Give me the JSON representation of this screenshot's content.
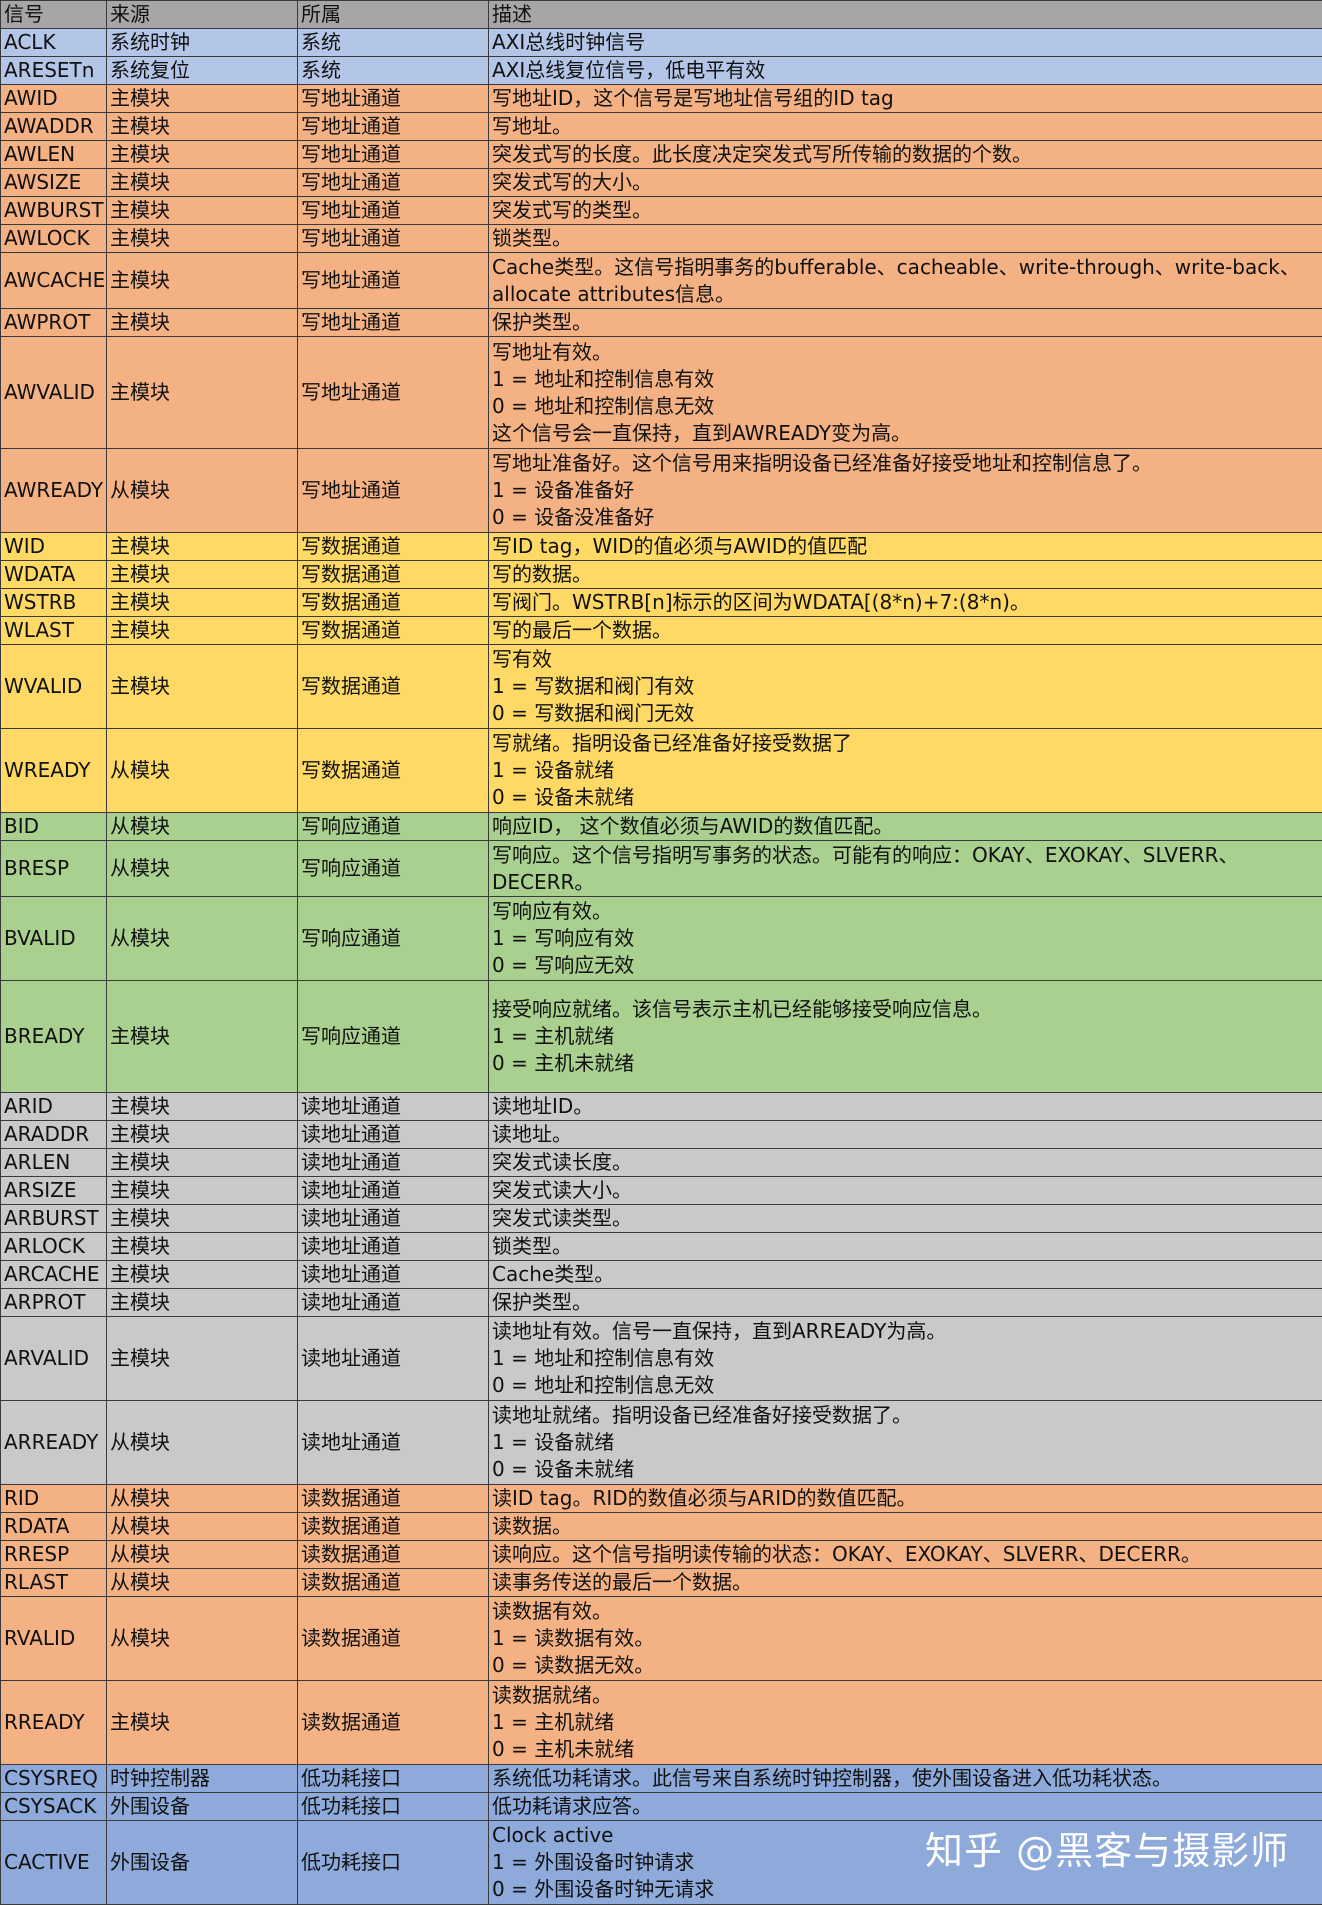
{
  "header": {
    "signal": "信号",
    "source": "来源",
    "group": "所属",
    "desc": "描述"
  },
  "rows": [
    {
      "cls": "sys",
      "h": 26,
      "signal": "ACLK",
      "source": "系统时钟",
      "group": "系统",
      "desc": [
        "AXI总线时钟信号"
      ]
    },
    {
      "cls": "sys",
      "h": 28,
      "signal": "ARESETn",
      "source": "系统复位",
      "group": "系统",
      "desc": [
        "AXI总线复位信号，低电平有效"
      ]
    },
    {
      "cls": "wa",
      "h": 28,
      "signal": "AWID",
      "source": "主模块",
      "group": "写地址通道",
      "desc": [
        "写地址ID，这个信号是写地址信号组的ID tag"
      ]
    },
    {
      "cls": "wa",
      "h": 28,
      "signal": "AWADDR",
      "source": "主模块",
      "group": "写地址通道",
      "desc": [
        "写地址。"
      ]
    },
    {
      "cls": "wa",
      "h": 28,
      "signal": "AWLEN",
      "source": "主模块",
      "group": "写地址通道",
      "desc": [
        "突发式写的长度。此长度决定突发式写所传输的数据的个数。"
      ]
    },
    {
      "cls": "wa",
      "h": 28,
      "signal": "AWSIZE",
      "source": "主模块",
      "group": "写地址通道",
      "desc": [
        "突发式写的大小。"
      ]
    },
    {
      "cls": "wa",
      "h": 28,
      "signal": "AWBURST",
      "source": "主模块",
      "group": "写地址通道",
      "desc": [
        "突发式写的类型。"
      ]
    },
    {
      "cls": "wa",
      "h": 28,
      "signal": "AWLOCK",
      "source": "主模块",
      "group": "写地址通道",
      "desc": [
        "锁类型。"
      ]
    },
    {
      "cls": "wa",
      "h": 56,
      "signal": "AWCACHE",
      "source": "主模块",
      "group": "写地址通道",
      "desc": [
        "Cache类型。这信号指明事务的bufferable、cacheable、write-through、write-back、allocate attributes信息。"
      ]
    },
    {
      "cls": "wa",
      "h": 28,
      "signal": "AWPROT",
      "source": "主模块",
      "group": "写地址通道",
      "desc": [
        "保护类型。"
      ]
    },
    {
      "cls": "wa",
      "h": 112,
      "signal": "AWVALID",
      "source": "主模块",
      "group": "写地址通道",
      "desc": [
        "写地址有效。",
        "1 = 地址和控制信息有效",
        "0 = 地址和控制信息无效",
        "这个信号会一直保持，直到AWREADY变为高。"
      ]
    },
    {
      "cls": "wa",
      "h": 84,
      "signal": "AWREADY",
      "source": "从模块",
      "group": "写地址通道",
      "desc": [
        "写地址准备好。这个信号用来指明设备已经准备好接受地址和控制信息了。",
        "1 = 设备准备好",
        "0 =  设备没准备好"
      ]
    },
    {
      "cls": "wd",
      "h": 28,
      "signal": "WID",
      "source": "主模块",
      "group": "写数据通道",
      "desc": [
        "写ID tag，WID的值必须与AWID的值匹配"
      ]
    },
    {
      "cls": "wd",
      "h": 28,
      "signal": "WDATA",
      "source": "主模块",
      "group": "写数据通道",
      "desc": [
        "写的数据。"
      ]
    },
    {
      "cls": "wd",
      "h": 28,
      "signal": "WSTRB",
      "source": "主模块",
      "group": "写数据通道",
      "desc": [
        "写阀门。WSTRB[n]标示的区间为WDATA[(8*n)+7:(8*n)。"
      ]
    },
    {
      "cls": "wd",
      "h": 28,
      "signal": "WLAST",
      "source": "主模块",
      "group": "写数据通道",
      "desc": [
        "写的最后一个数据。"
      ]
    },
    {
      "cls": "wd",
      "h": 84,
      "signal": "WVALID",
      "source": "主模块",
      "group": "写数据通道",
      "desc": [
        "写有效",
        "1 = 写数据和阀门有效",
        "0 =  写数据和阀门无效"
      ]
    },
    {
      "cls": "wd",
      "h": 84,
      "signal": "WREADY",
      "source": "从模块",
      "group": "写数据通道",
      "desc": [
        "写就绪。指明设备已经准备好接受数据了",
        "1 = 设备就绪",
        "0 = 设备未就绪"
      ]
    },
    {
      "cls": "wr",
      "h": 28,
      "signal": "BID",
      "source": "从模块",
      "group": "写响应通道",
      "desc": [
        "响应ID，  这个数值必须与AWID的数值匹配。"
      ]
    },
    {
      "cls": "wr",
      "h": 56,
      "signal": "BRESP",
      "source": "从模块",
      "group": "写响应通道",
      "desc": [
        "写响应。这个信号指明写事务的状态。可能有的响应：OKAY、EXOKAY、SLVERR、DECERR。"
      ]
    },
    {
      "cls": "wr",
      "h": 84,
      "signal": "BVALID",
      "source": "从模块",
      "group": "写响应通道",
      "desc": [
        "写响应有效。",
        "1 = 写响应有效",
        "0 = 写响应无效"
      ]
    },
    {
      "cls": "wr",
      "h": 112,
      "signal": "BREADY",
      "source": "主模块",
      "group": "写响应通道",
      "desc": [
        "接受响应就绪。该信号表示主机已经能够接受响应信息。",
        "1 = 主机就绪",
        "0 = 主机未就绪"
      ]
    },
    {
      "cls": "ra",
      "h": 28,
      "signal": "ARID",
      "source": "主模块",
      "group": "读地址通道",
      "desc": [
        "读地址ID。"
      ]
    },
    {
      "cls": "ra",
      "h": 28,
      "signal": "ARADDR",
      "source": "主模块",
      "group": "读地址通道",
      "desc": [
        "读地址。"
      ]
    },
    {
      "cls": "ra",
      "h": 28,
      "signal": "ARLEN",
      "source": "主模块",
      "group": "读地址通道",
      "desc": [
        "突发式读长度。"
      ]
    },
    {
      "cls": "ra",
      "h": 28,
      "signal": "ARSIZE",
      "source": "主模块",
      "group": "读地址通道",
      "desc": [
        "突发式读大小。"
      ]
    },
    {
      "cls": "ra",
      "h": 28,
      "signal": "ARBURST",
      "source": "主模块",
      "group": "读地址通道",
      "desc": [
        "突发式读类型。"
      ]
    },
    {
      "cls": "ra",
      "h": 28,
      "signal": "ARLOCK",
      "source": "主模块",
      "group": "读地址通道",
      "desc": [
        "锁类型。"
      ]
    },
    {
      "cls": "ra",
      "h": 28,
      "signal": "ARCACHE",
      "source": "主模块",
      "group": "读地址通道",
      "desc": [
        "Cache类型。"
      ]
    },
    {
      "cls": "ra",
      "h": 28,
      "signal": "ARPROT",
      "source": "主模块",
      "group": "读地址通道",
      "desc": [
        "保护类型。"
      ]
    },
    {
      "cls": "ra",
      "h": 84,
      "signal": "ARVALID",
      "source": "主模块",
      "group": "读地址通道",
      "desc": [
        "读地址有效。信号一直保持，直到ARREADY为高。",
        "1 = 地址和控制信息有效",
        "0 = 地址和控制信息无效"
      ]
    },
    {
      "cls": "ra",
      "h": 84,
      "signal": "ARREADY",
      "source": "从模块",
      "group": "读地址通道",
      "desc": [
        "读地址就绪。指明设备已经准备好接受数据了。",
        "1 = 设备就绪",
        "0 = 设备未就绪"
      ]
    },
    {
      "cls": "rd",
      "h": 28,
      "signal": "RID",
      "source": "从模块",
      "group": "读数据通道",
      "desc": [
        "读ID tag。RID的数值必须与ARID的数值匹配。"
      ]
    },
    {
      "cls": "rd",
      "h": 28,
      "signal": "RDATA",
      "source": "从模块",
      "group": "读数据通道",
      "desc": [
        "读数据。"
      ]
    },
    {
      "cls": "rd",
      "h": 28,
      "signal": "RRESP",
      "source": "从模块",
      "group": "读数据通道",
      "desc": [
        "读响应。这个信号指明读传输的状态：OKAY、EXOKAY、SLVERR、DECERR。"
      ]
    },
    {
      "cls": "rd",
      "h": 28,
      "signal": "RLAST",
      "source": "从模块",
      "group": "读数据通道",
      "desc": [
        "读事务传送的最后一个数据。"
      ]
    },
    {
      "cls": "rd",
      "h": 84,
      "signal": "RVALID",
      "source": "从模块",
      "group": "读数据通道",
      "desc": [
        "读数据有效。",
        "1 = 读数据有效。",
        "0 = 读数据无效。"
      ]
    },
    {
      "cls": "rd",
      "h": 84,
      "signal": "RREADY",
      "source": "主模块",
      "group": "读数据通道",
      "desc": [
        "读数据就绪。",
        "1 = 主机就绪",
        "0 = 主机未就绪"
      ]
    },
    {
      "cls": "lp",
      "h": 28,
      "signal": "CSYSREQ",
      "source": "时钟控制器",
      "group": "低功耗接口",
      "desc": [
        "系统低功耗请求。此信号来自系统时钟控制器，使外围设备进入低功耗状态。"
      ]
    },
    {
      "cls": "lp",
      "h": 28,
      "signal": "CSYSACK",
      "source": "外围设备",
      "group": "低功耗接口",
      "desc": [
        "低功耗请求应答。"
      ]
    },
    {
      "cls": "lp",
      "h": 84,
      "signal": "CACTIVE",
      "source": "外围设备",
      "group": "低功耗接口",
      "desc": [
        "Clock active",
        "1 = 外围设备时钟请求",
        "0 = 外围设备时钟无请求"
      ]
    }
  ],
  "watermark": "知乎 @黑客与摄影师"
}
